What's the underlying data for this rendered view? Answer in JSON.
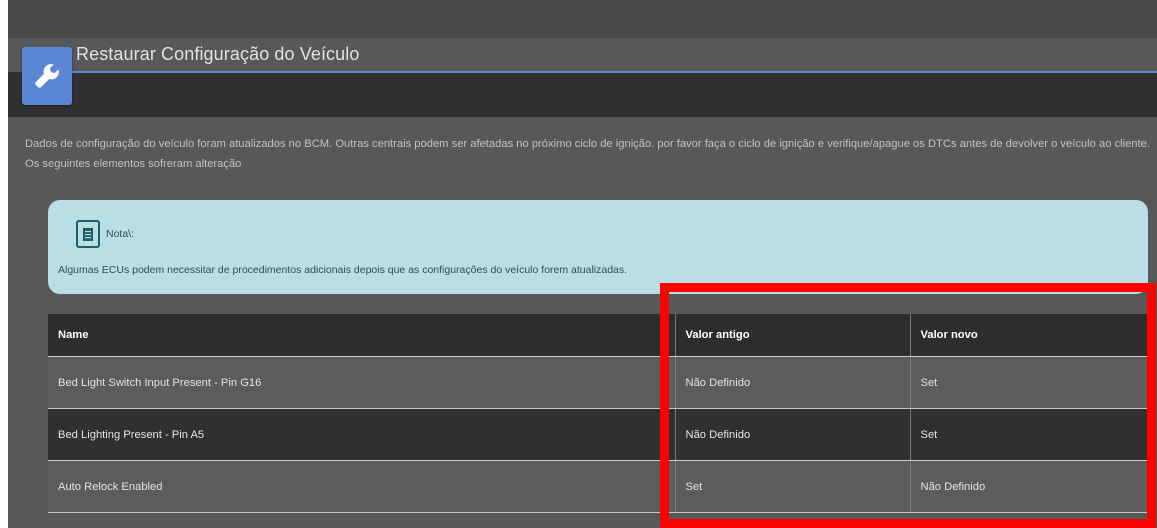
{
  "window": {
    "title": "Restaurar Configuração do Veículo"
  },
  "icons": {
    "header": "wrench-icon",
    "note": "document-icon"
  },
  "colors": {
    "header_icon_bg": "#5b86d4",
    "note_bg": "#b9dfe4",
    "highlight": "#ff0000"
  },
  "description": "Dados de configuração do veículo foram atualizados no BCM. Outras centrais podem ser afetadas no próximo ciclo de ignição. por favor faça o ciclo de ignição e verifique/apague os DTCs antes de devolver o veículo ao cliente. Os seguintes elementos sofreram alteração",
  "note": {
    "title": "Nota\\:",
    "text": "Algumas ECUs podem necessitar de procedimentos adicionais depois que as configurações do veículo forem atualizadas."
  },
  "table": {
    "headers": [
      "Name",
      "Valor antigo",
      "Valor novo"
    ],
    "rows": [
      [
        "Bed Light Switch Input Present - Pin G16",
        "Não Definido",
        "Set"
      ],
      [
        "Bed Lighting Present - Pin A5",
        "Não Definido",
        "Set"
      ],
      [
        "Auto Relock Enabled",
        "Set",
        "Não Definido"
      ]
    ]
  }
}
